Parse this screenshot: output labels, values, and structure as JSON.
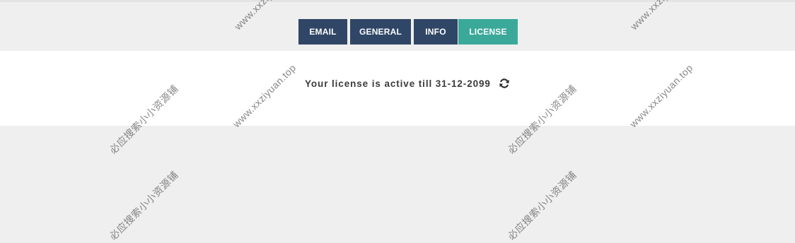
{
  "tabs": [
    {
      "label": "EMAIL",
      "active": false
    },
    {
      "label": "GENERAL",
      "active": false
    },
    {
      "label": "INFO",
      "active": false
    },
    {
      "label": "LICENSE",
      "active": true
    }
  ],
  "license": {
    "status_text": "Your license is active till 31-12-2099",
    "refresh_icon": "refresh-icon"
  },
  "watermark": {
    "url_text": "www.xxziyuan.top",
    "cn_text": "必应搜索小小资源铺"
  },
  "colors": {
    "tab_dark": "#304666",
    "tab_active": "#3aa99a",
    "page_bg": "#efefef",
    "panel_bg": "#ffffff",
    "text": "#3b3b3b"
  }
}
